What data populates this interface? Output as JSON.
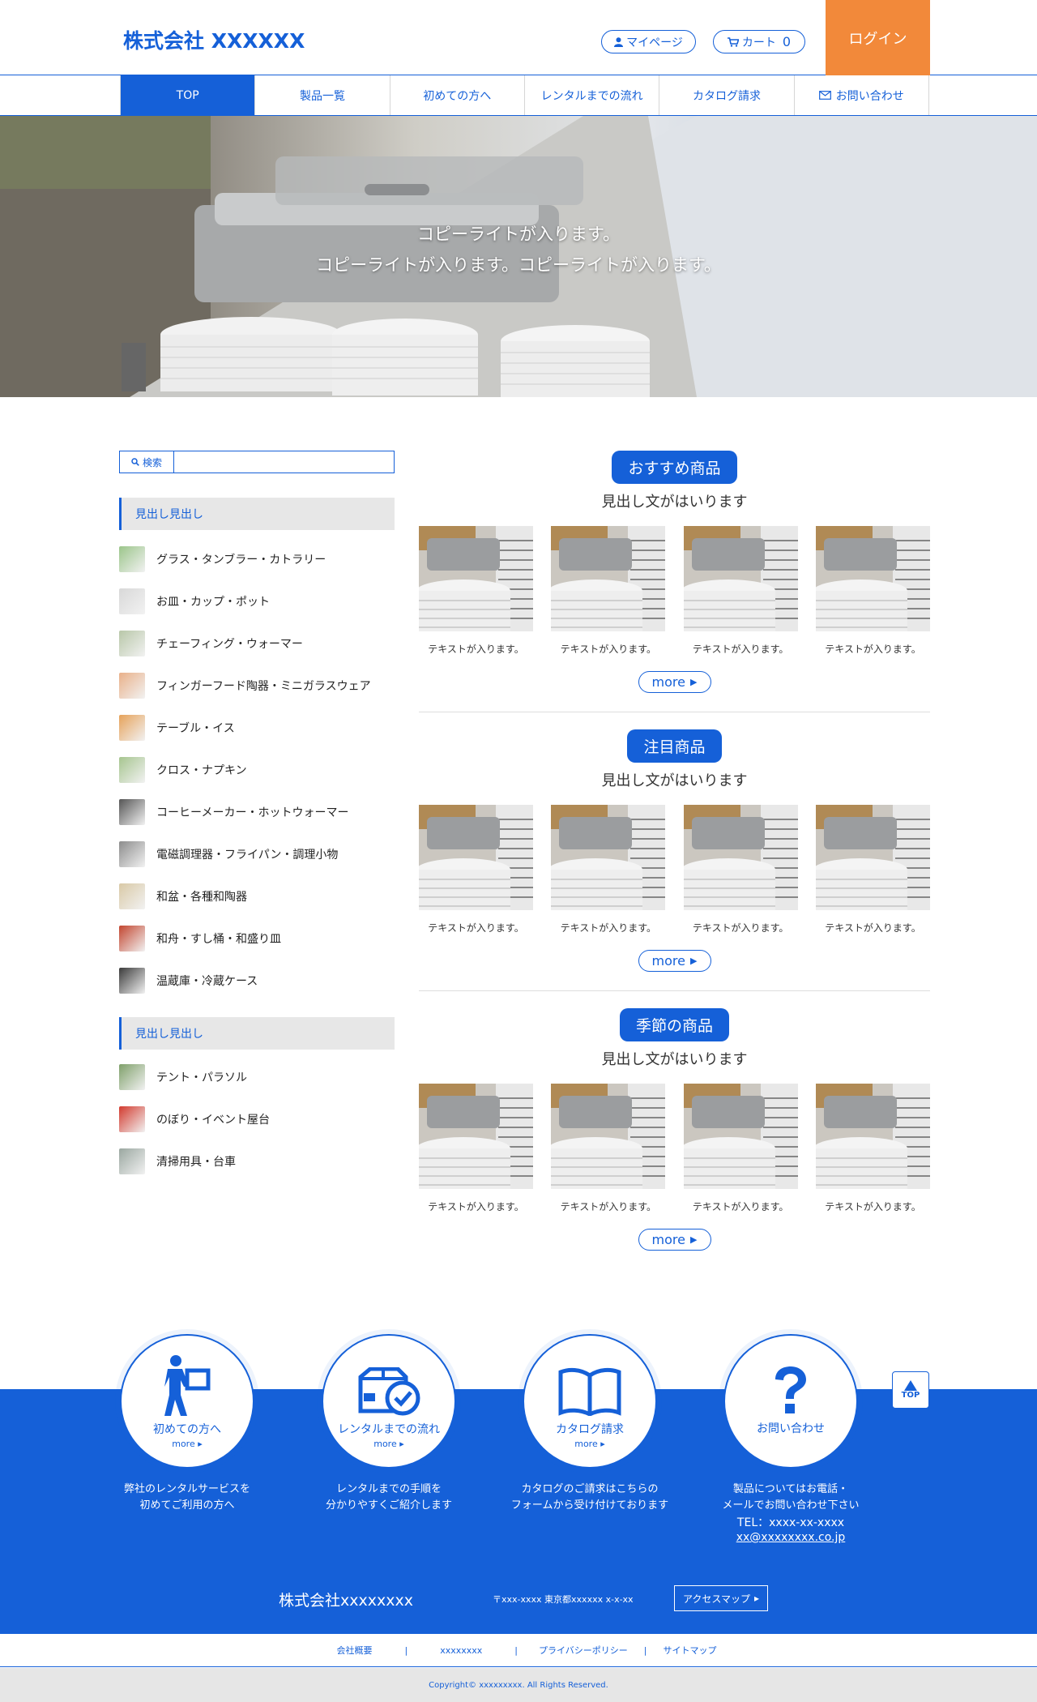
{
  "header": {
    "logo": "株式会社 XXXXXX",
    "mypage": "マイページ",
    "cart_label": "カート",
    "cart_count": "0",
    "login": "ログイン"
  },
  "nav": [
    "TOP",
    "製品一覧",
    "初めての方へ",
    "レンタルまでの流れ",
    "カタログ請求",
    "お問い合わせ"
  ],
  "hero": {
    "line1": "コピーライトが入ります。",
    "line2": "コピーライトが入ります。コピーライトが入ります。"
  },
  "search": {
    "button": "検索",
    "placeholder": ""
  },
  "sidebar": {
    "heading1": "見出し見出し",
    "items1": [
      {
        "label": "グラス・タンブラー・カトラリー",
        "color": "#9bc58a"
      },
      {
        "label": "お皿・カップ・ポット",
        "color": "#d8d8d8"
      },
      {
        "label": "チェーフィング・ウォーマー",
        "color": "#b8c7a8"
      },
      {
        "label": "フィンガーフード陶器・ミニガラスウェア",
        "color": "#e9b089"
      },
      {
        "label": "テーブル・イス",
        "color": "#e6a25a"
      },
      {
        "label": "クロス・ナプキン",
        "color": "#a6c58f"
      },
      {
        "label": "コーヒーメーカー・ホットウォーマー",
        "color": "#555555"
      },
      {
        "label": "電磁調理器・フライパン・調理小物",
        "color": "#8c8c8c"
      },
      {
        "label": "和盆・各種和陶器",
        "color": "#d9c9a6"
      },
      {
        "label": "和舟・すし桶・和盛り皿",
        "color": "#c2452f"
      },
      {
        "label": "温蔵庫・冷蔵ケース",
        "color": "#3a3a3a"
      }
    ],
    "heading2": "見出し見出し",
    "items2": [
      {
        "label": "テント・パラソル",
        "color": "#7fa06a"
      },
      {
        "label": "のぼり・イベント屋台",
        "color": "#d23a2e"
      },
      {
        "label": "清掃用具・台車",
        "color": "#9aa7a0"
      }
    ]
  },
  "sections": [
    {
      "title": "おすすめ商品",
      "subtitle": "見出し文がはいります",
      "captions": [
        "テキストが入ります。",
        "テキストが入ります。",
        "テキストが入ります。",
        "テキストが入ります。"
      ],
      "more": "more"
    },
    {
      "title": "注目商品",
      "subtitle": "見出し文がはいります",
      "captions": [
        "テキストが入ります。",
        "テキストが入ります。",
        "テキストが入ります。",
        "テキストが入ります。"
      ],
      "more": "more"
    },
    {
      "title": "季節の商品",
      "subtitle": "見出し文がはいります",
      "captions": [
        "テキストが入ります。",
        "テキストが入ります。",
        "テキストが入ります。",
        "テキストが入ります。"
      ],
      "more": "more"
    }
  ],
  "footer": {
    "cards": [
      {
        "title": "初めての方へ",
        "more": "more",
        "desc1": "弊社のレンタルサービスを",
        "desc2": "初めてご利用の方へ"
      },
      {
        "title": "レンタルまでの流れ",
        "more": "more",
        "desc1": "レンタルまでの手順を",
        "desc2": "分かりやすくご紹介します"
      },
      {
        "title": "カタログ請求",
        "more": "more",
        "desc1": "カタログのご請求はこちらの",
        "desc2": "フォームから受け付けております"
      },
      {
        "title": "お問い合わせ",
        "desc1": "製品についてはお電話・",
        "desc2": "メールでお問い合わせ下さい",
        "tel": "TEL：xxxx-xx-xxxx",
        "mail": "xx@xxxxxxxx.co.jp"
      }
    ],
    "top": "TOP",
    "company": "株式会社xxxxxxxx",
    "address": "〒xxx-xxxx 東京都xxxxxx x-x-xx",
    "access": "アクセスマップ",
    "links": [
      "会社概要",
      "xxxxxxxx",
      "プライバシーポリシー",
      "サイトマップ"
    ],
    "copyright": "Copyright© xxxxxxxxx. All Rights Reserved."
  },
  "colors": {
    "brand": "#1560d8",
    "login": "#f2893a"
  }
}
